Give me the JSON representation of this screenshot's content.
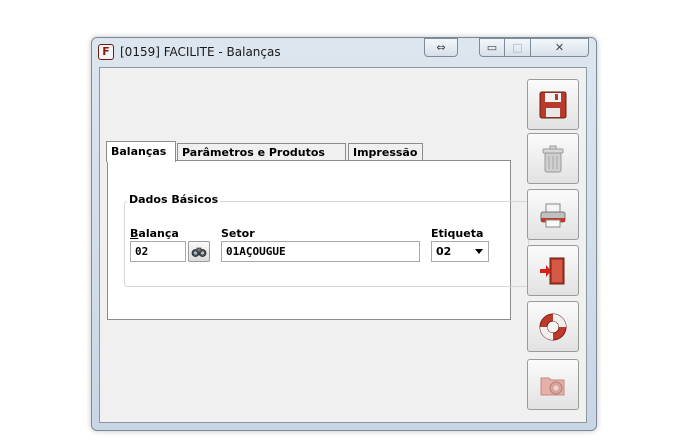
{
  "window": {
    "title": "[0159] FACILITE - Balanças",
    "app_icon_letter": "F"
  },
  "title_buttons": {
    "resize": "⇔",
    "minimize": "▭",
    "maximize": "□",
    "close": "✕"
  },
  "tabs": [
    {
      "label": "Balanças",
      "active": true
    },
    {
      "label": "Parâmetros e Produtos",
      "active": false
    },
    {
      "label": "Impressão",
      "active": false
    }
  ],
  "group": {
    "label": "Dados Básicos"
  },
  "fields": {
    "balanca": {
      "label_underlined": "B",
      "label_rest": "alança",
      "value": "02"
    },
    "setor": {
      "label": "Setor",
      "value": "01AÇOUGUE"
    },
    "etiqueta": {
      "label": "Etiqueta",
      "value": "02"
    }
  },
  "toolbar": {
    "save": {
      "icon": "floppy-disk-icon",
      "enabled": true
    },
    "delete": {
      "icon": "trash-can-icon",
      "enabled": false
    },
    "print": {
      "icon": "printer-icon",
      "enabled": true
    },
    "exit": {
      "icon": "exit-door-icon",
      "enabled": true
    },
    "help": {
      "icon": "lifebuoy-icon",
      "enabled": true
    },
    "config": {
      "icon": "folder-gear-icon",
      "enabled": false
    }
  },
  "colors": {
    "accent_red": "#c0392b",
    "window_frame": "#c9d6e3"
  }
}
